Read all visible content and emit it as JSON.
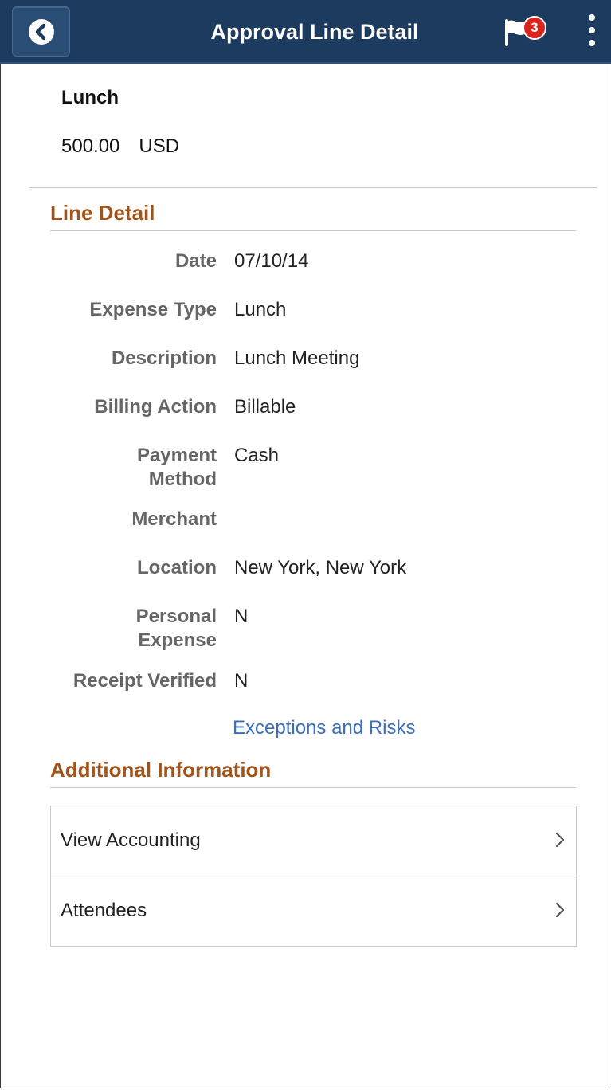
{
  "header": {
    "title": "Approval Line Detail",
    "notification_count": "3",
    "bg_color": "#1d3b5f"
  },
  "summary": {
    "title": "Lunch",
    "amount": "500.00",
    "currency": "USD"
  },
  "line_detail": {
    "heading": "Line Detail",
    "fields": [
      {
        "label": "Date",
        "value": "07/10/14"
      },
      {
        "label": "Expense Type",
        "value": "Lunch"
      },
      {
        "label": "Description",
        "value": "Lunch Meeting"
      },
      {
        "label": "Billing Action",
        "value": "Billable"
      },
      {
        "label_line1": "Payment",
        "label_line2": "Method",
        "value": "Cash"
      },
      {
        "label": "Merchant",
        "value": ""
      },
      {
        "label": "Location",
        "value": "New York, New York"
      },
      {
        "label_line1": "Personal",
        "label_line2": "Expense",
        "value": "N"
      },
      {
        "label": "Receipt Verified",
        "value": "N"
      }
    ],
    "link": "Exceptions and Risks"
  },
  "additional": {
    "heading": "Additional Information",
    "items": [
      {
        "label": "View Accounting"
      },
      {
        "label": "Attendees"
      }
    ]
  },
  "icons": {
    "back": "chevron-left-circle-icon",
    "flag": "flag-icon",
    "menu": "kebab-menu-icon",
    "item_chevron": "chevron-right-icon"
  },
  "colors": {
    "heading": "#a0541b",
    "link": "#3a6fbf",
    "badge": "#d9231f"
  }
}
